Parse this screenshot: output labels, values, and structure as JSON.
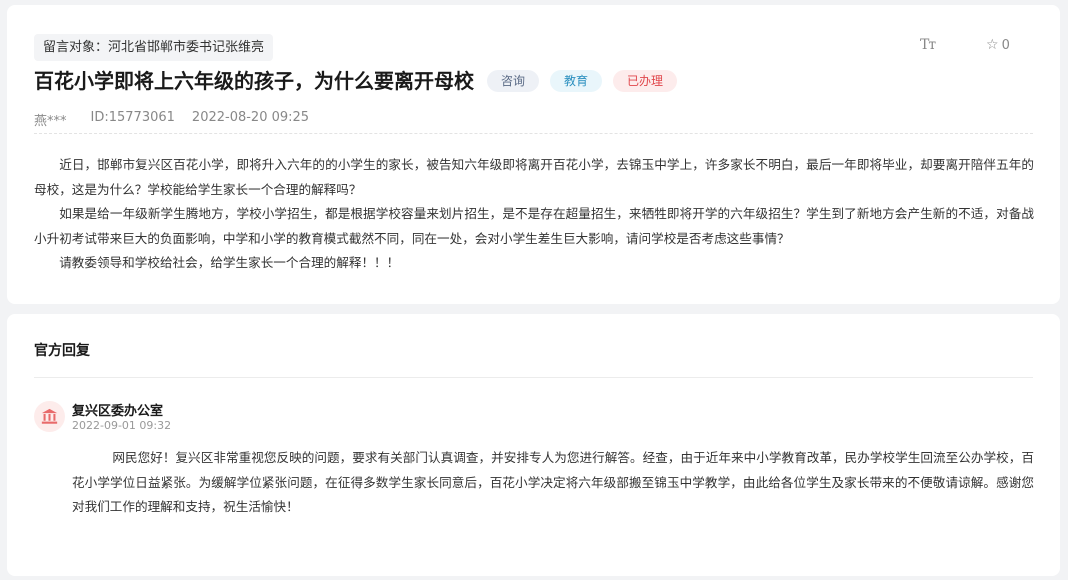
{
  "message": {
    "target": "留言对象：河北省邯郸市委书记张维亮",
    "font_toggle_label": "Tт",
    "favorite_count": "0",
    "title": "百花小学即将上六年级的孩子，为什么要离开母校",
    "tags": [
      "咨询",
      "教育",
      "已办理"
    ],
    "author": "燕***",
    "id": "ID:15773061",
    "datetime": "2022-08-20 09:25",
    "paragraphs": [
      "近日，邯郸市复兴区百花小学，即将升入六年的的小学生的家长，被告知六年级即将离开百花小学，去锦玉中学上，许多家长不明白，最后一年即将毕业，却要离开陪伴五年的母校，这是为什么？学校能给学生家长一个合理的解释吗？",
      "如果是给一年级新学生腾地方，学校小学招生，都是根据学校容量来划片招生，是不是存在超量招生，来牺牲即将开学的六年级招生？学生到了新地方会产生新的不适，对备战小升初考试带来巨大的负面影响，中学和小学的教育模式截然不同，同在一处，会对小学生差生巨大影响，请问学校是否考虑这些事情？",
      "请教委领导和学校给社会，给学生家长一个合理的解释！！！"
    ]
  },
  "reply": {
    "heading": "官方回复",
    "org_name": "复兴区委办公室",
    "datetime": "2022-09-01 09:32",
    "text": "网民您好！复兴区非常重视您反映的问题，要求有关部门认真调查，并安排专人为您进行解答。经查，由于近年来中小学教育改革，民办学校学生回流至公办学校，百花小学学位日益紧张。为缓解学位紧张问题，在征得多数学生家长同意后，百花小学决定将六年级部搬至锦玉中学教学，由此给各位学生及家长带来的不便敬请谅解。感谢您对我们工作的理解和支持，祝生活愉快！"
  },
  "icons": {
    "favorite": "star-outline-icon",
    "org_avatar": "government-building-icon"
  },
  "colors": {
    "tag_done": "#e0474c",
    "tag_edu": "#2a8fbf",
    "tag_consult": "#5a6a85",
    "avatar_icon": "#e86a6a"
  }
}
